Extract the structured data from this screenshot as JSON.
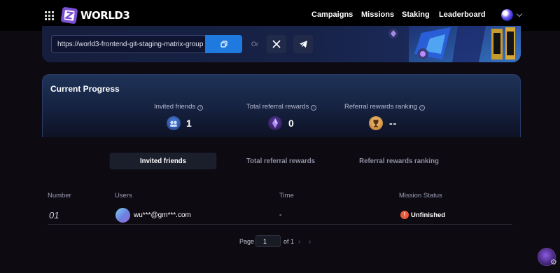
{
  "header": {
    "logo_text": "WORLD3",
    "nav": [
      {
        "label": "Campaigns"
      },
      {
        "label": "Missions"
      },
      {
        "label": "Staking"
      },
      {
        "label": "Leaderboard"
      }
    ]
  },
  "invite": {
    "link_value": "https://world3-frontend-git-staging-matrix-group",
    "or_text": "Or"
  },
  "progress": {
    "title": "Current Progress",
    "stats": [
      {
        "label": "Invited friends",
        "value": "1"
      },
      {
        "label": "Total referral rewards",
        "value": "0"
      },
      {
        "label": "Referral rewards ranking",
        "value": "--"
      }
    ]
  },
  "tabs": [
    {
      "label": "Invited friends",
      "active": true
    },
    {
      "label": "Total referral rewards",
      "active": false
    },
    {
      "label": "Referral rewards ranking",
      "active": false
    }
  ],
  "table": {
    "headers": [
      "Number",
      "Users",
      "Time",
      "Mission Status"
    ],
    "rows": [
      {
        "number": "01",
        "user": "wu***@gm***.com",
        "time": "-",
        "status": "Unfinished"
      }
    ]
  },
  "pagination": {
    "page_label": "Page",
    "current_page": "1",
    "of_label": "of 1"
  },
  "colors": {
    "accent": "#1f7ae0",
    "status_unfinished": "#e85a3a"
  }
}
